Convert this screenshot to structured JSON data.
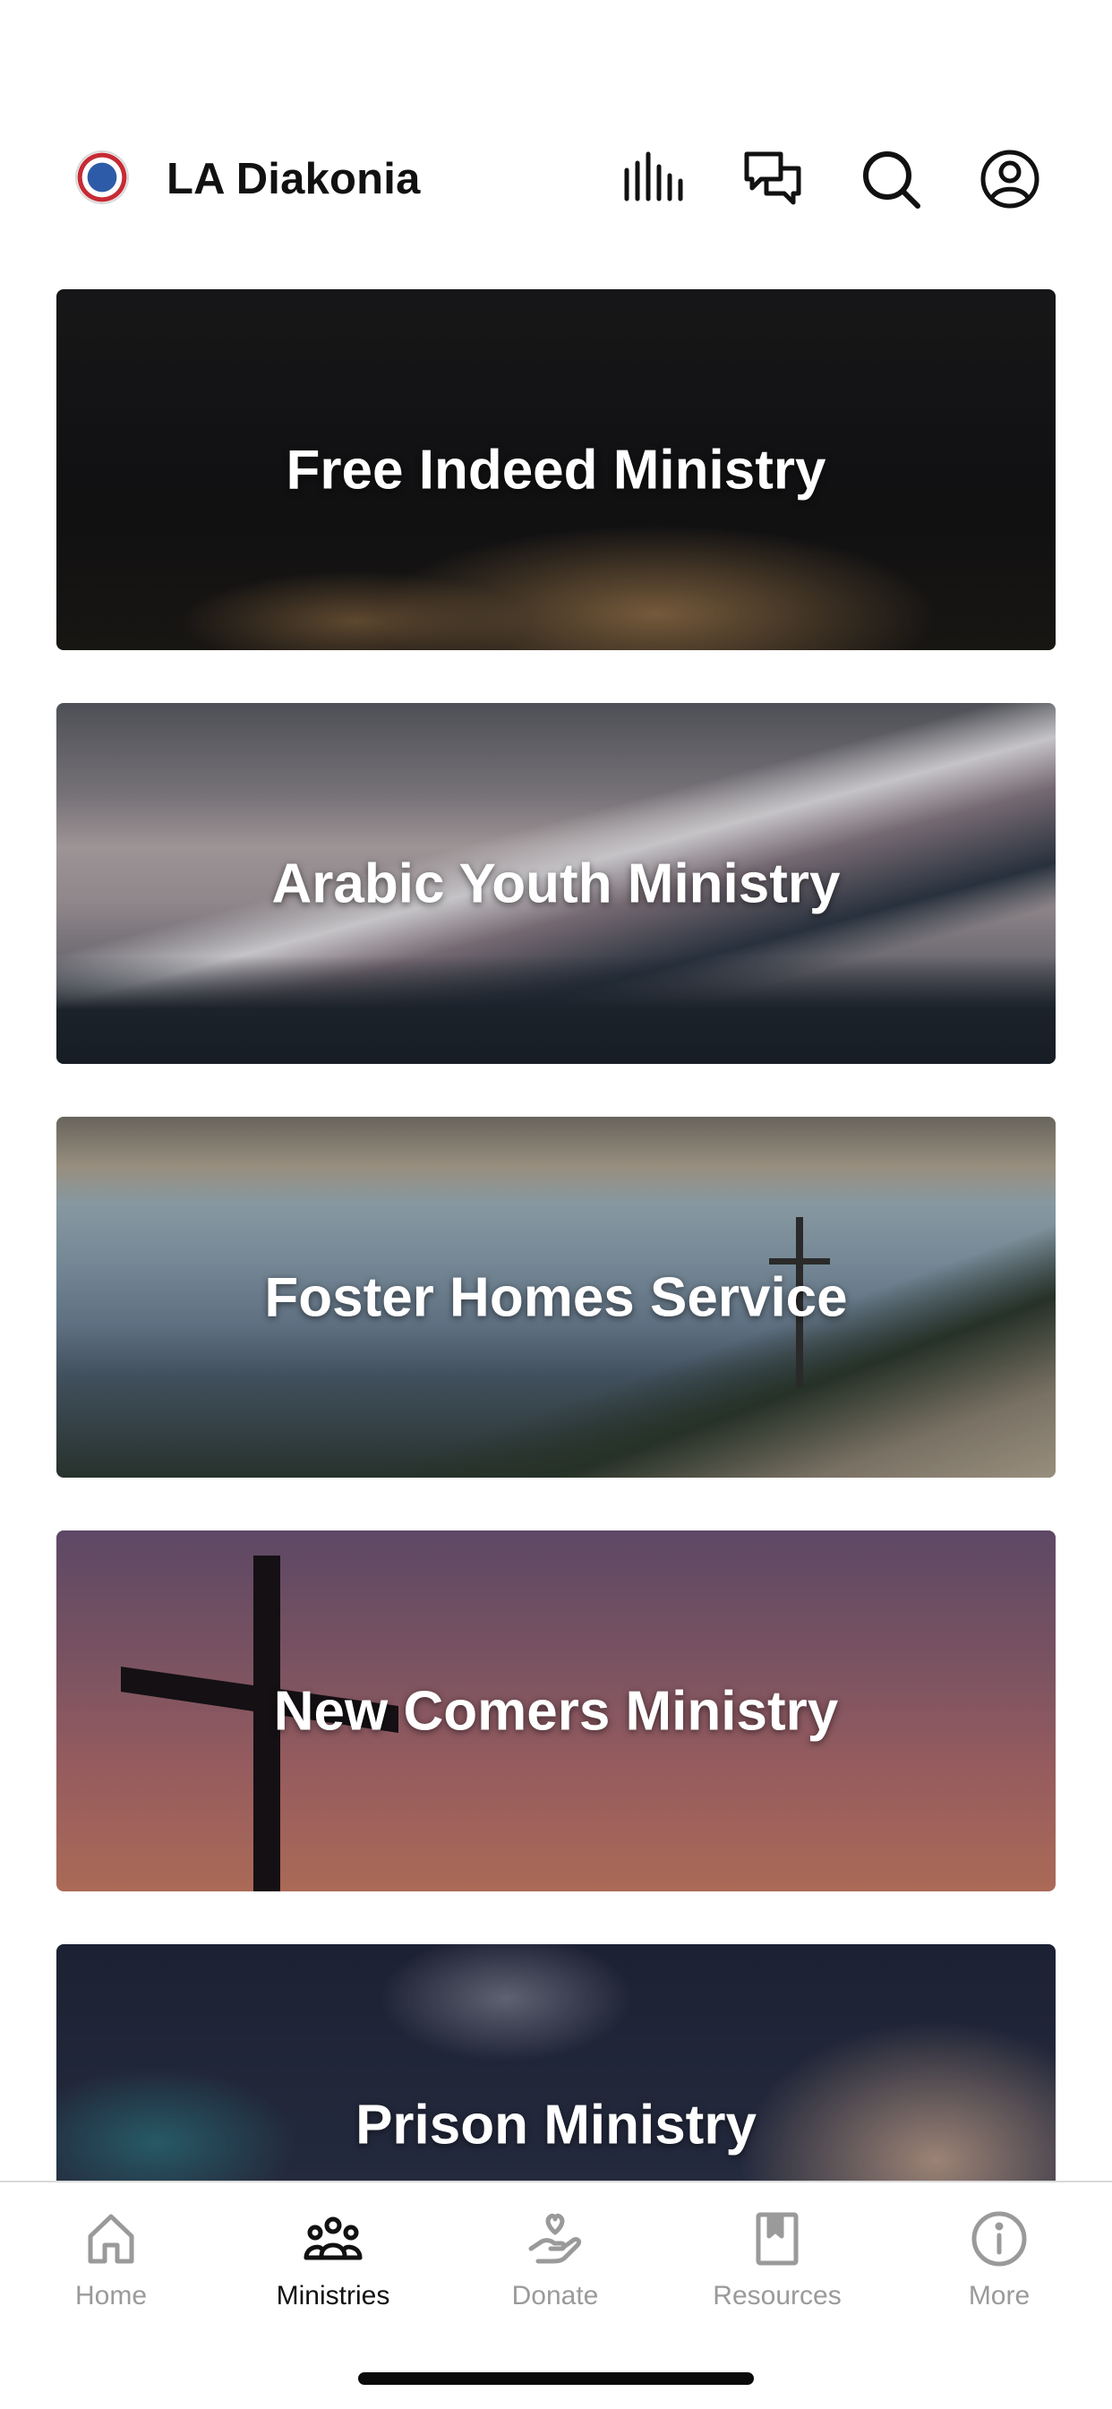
{
  "header": {
    "app_title": "LA Diakonia",
    "icons": [
      "audio-bars-icon",
      "chat-icon",
      "search-icon",
      "account-icon"
    ]
  },
  "ministries": [
    {
      "title": "Free Indeed Ministry",
      "image": "worship-hands-image"
    },
    {
      "title": "Arabic Youth Ministry",
      "image": "snowy-mountains-image"
    },
    {
      "title": "Foster Homes Service",
      "image": "mountain-cross-image"
    },
    {
      "title": "New Comers Ministry",
      "image": "sunset-cross-image"
    },
    {
      "title": "Prison Ministry",
      "image": "bible-hands-image"
    }
  ],
  "nav": {
    "items": [
      {
        "label": "Home",
        "icon": "home-icon",
        "active": false
      },
      {
        "label": "Ministries",
        "icon": "people-group-icon",
        "active": true
      },
      {
        "label": "Donate",
        "icon": "heart-hand-icon",
        "active": false
      },
      {
        "label": "Resources",
        "icon": "bookmark-book-icon",
        "active": false
      },
      {
        "label": "More",
        "icon": "info-circle-icon",
        "active": false
      }
    ]
  },
  "colors": {
    "active": "#111111",
    "inactive": "#9a9a9a"
  }
}
